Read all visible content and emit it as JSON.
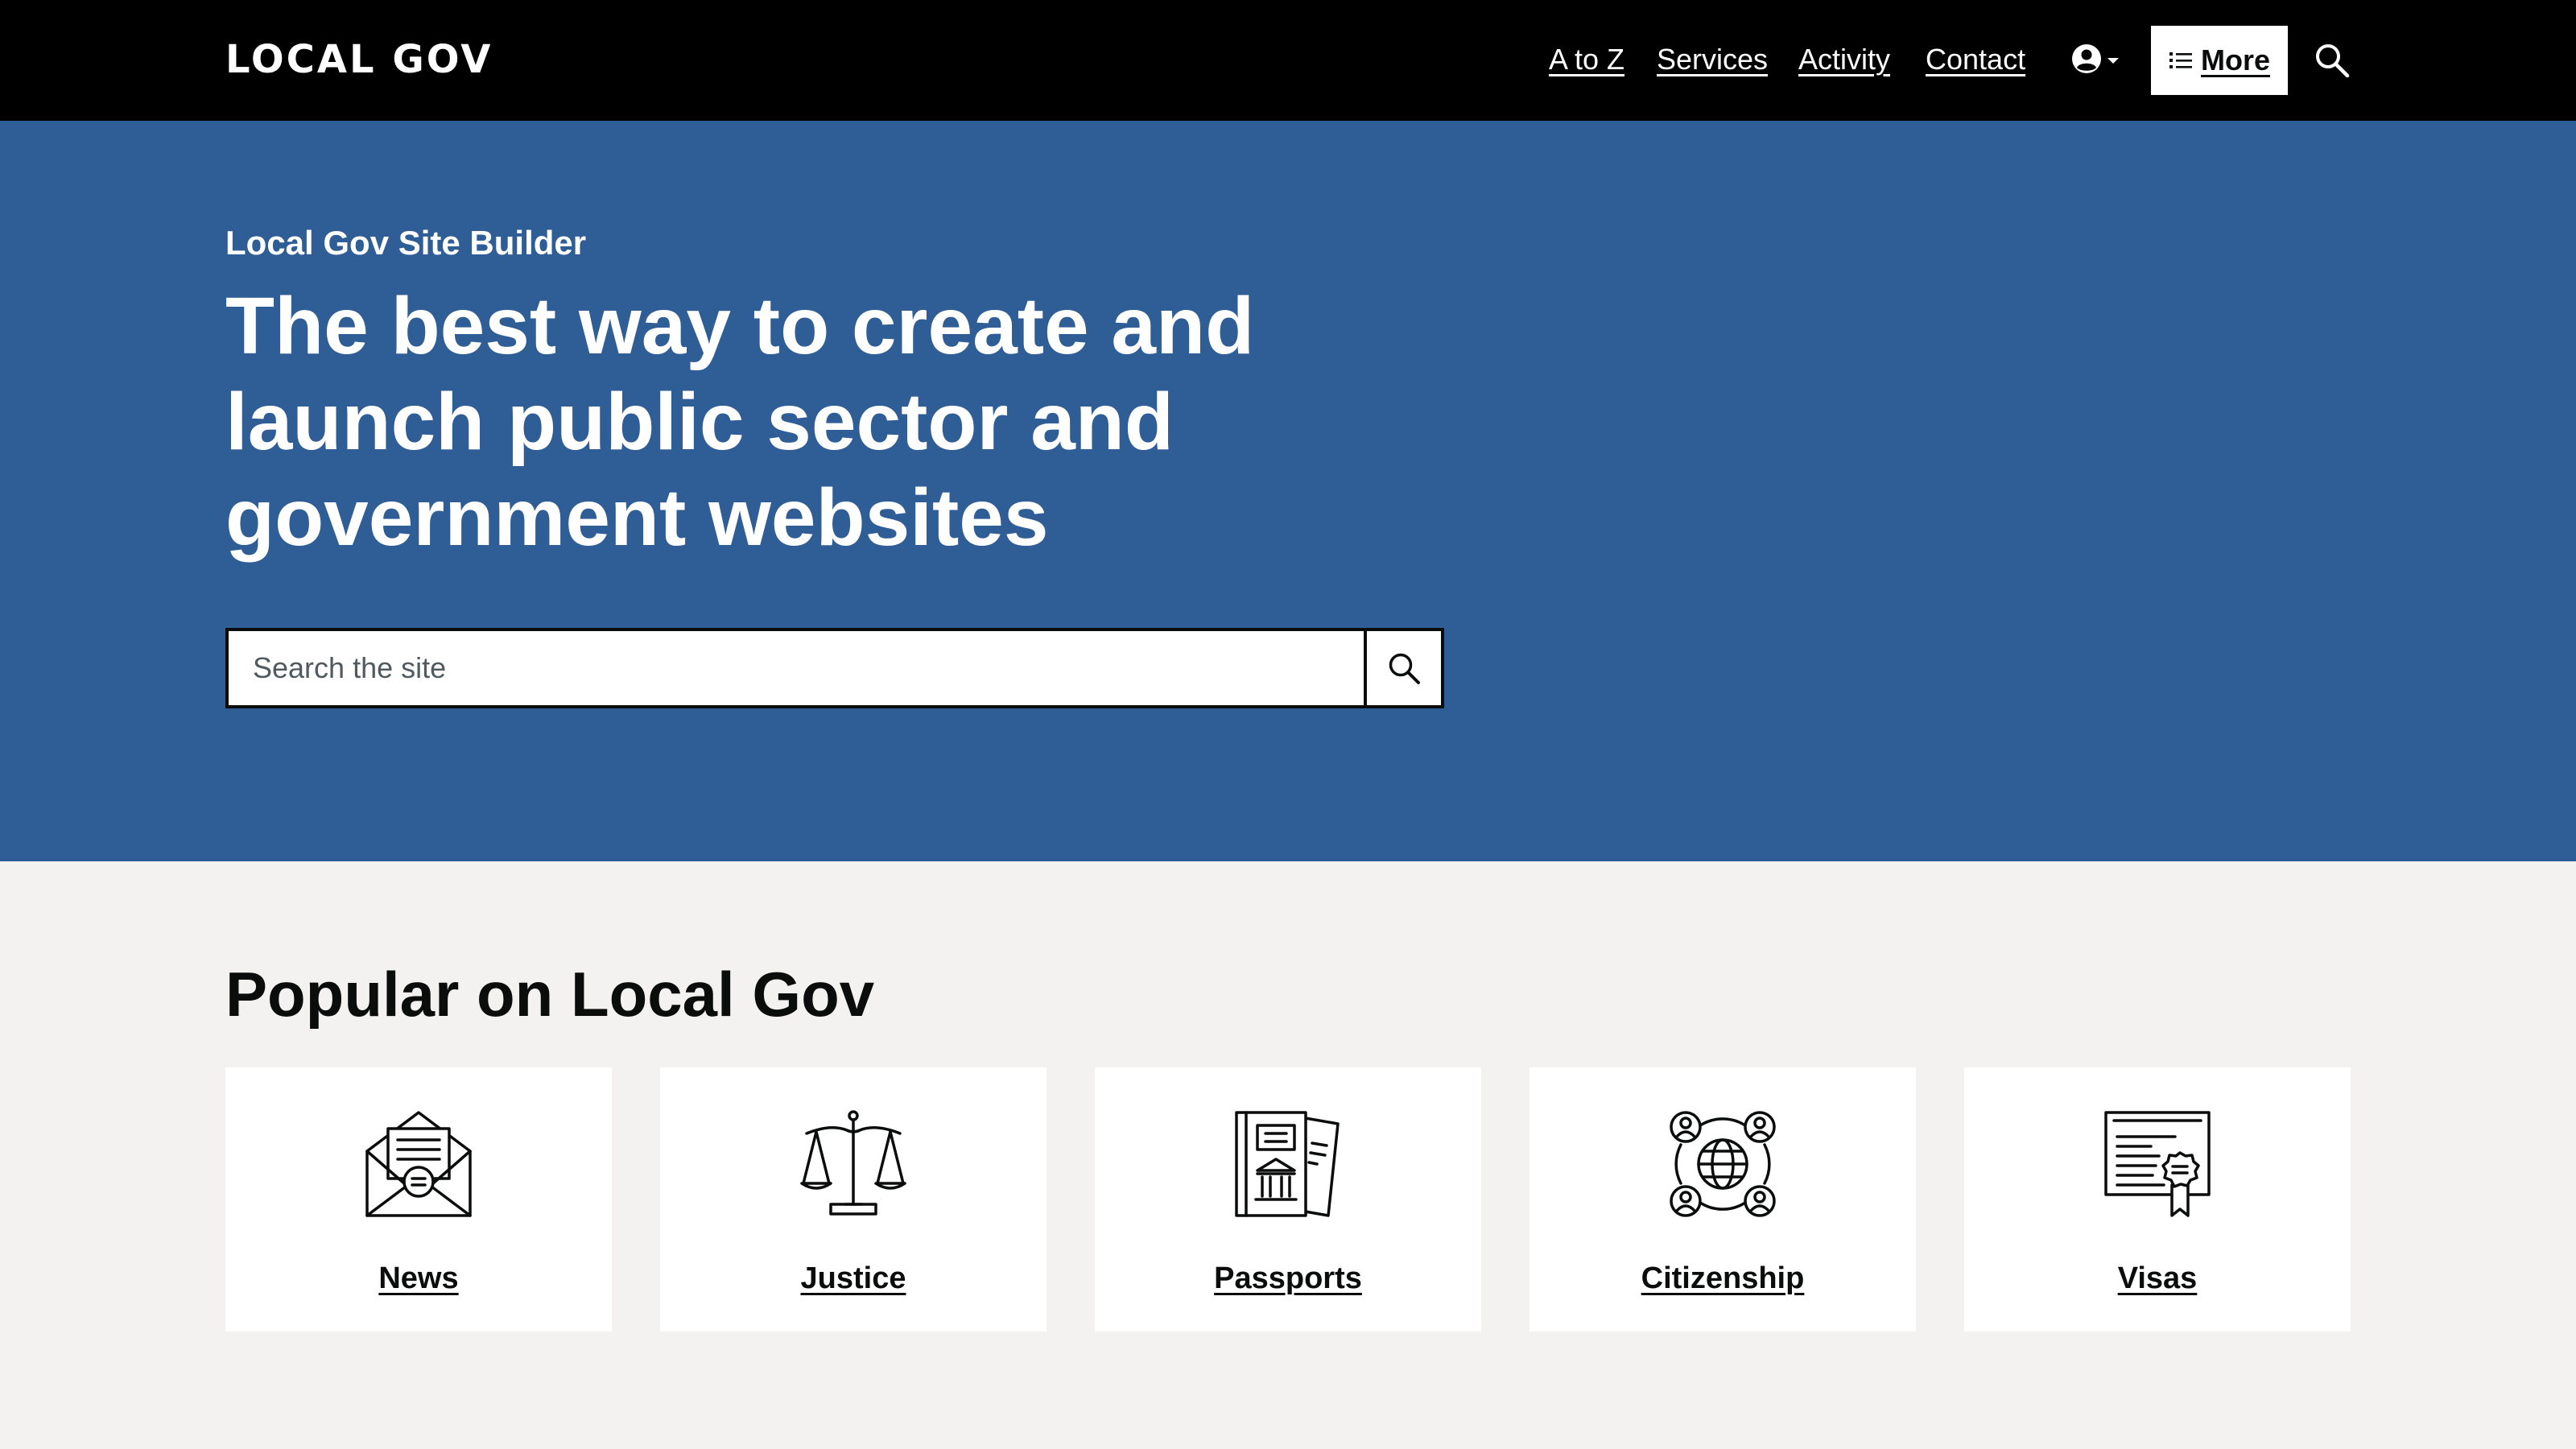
{
  "header": {
    "logo": "LOCAL GOV",
    "nav": [
      "A to Z",
      "Services",
      "Activity",
      "Contact"
    ],
    "account_icon": "user-circle-icon",
    "more_label": "More",
    "more_icon": "list-icon",
    "search_icon": "search-icon"
  },
  "hero": {
    "kicker": "Local Gov Site Builder",
    "title": "The best way to create and launch public sector and government websites",
    "search": {
      "placeholder": "Search the site",
      "value": "",
      "submit_icon": "search-icon"
    }
  },
  "popular": {
    "title": "Popular on Local Gov",
    "cards": [
      {
        "label": "News",
        "icon": "envelope-news-icon"
      },
      {
        "label": "Justice",
        "icon": "scales-icon"
      },
      {
        "label": "Passports",
        "icon": "passport-document-icon"
      },
      {
        "label": "Citizenship",
        "icon": "globe-people-icon"
      },
      {
        "label": "Visas",
        "icon": "certificate-icon"
      }
    ]
  },
  "colors": {
    "header_bg": "#000000",
    "hero_bg": "#2f5d95",
    "page_bg": "#f3f2f1",
    "card_bg": "#ffffff",
    "text": "#0b0c0c"
  }
}
